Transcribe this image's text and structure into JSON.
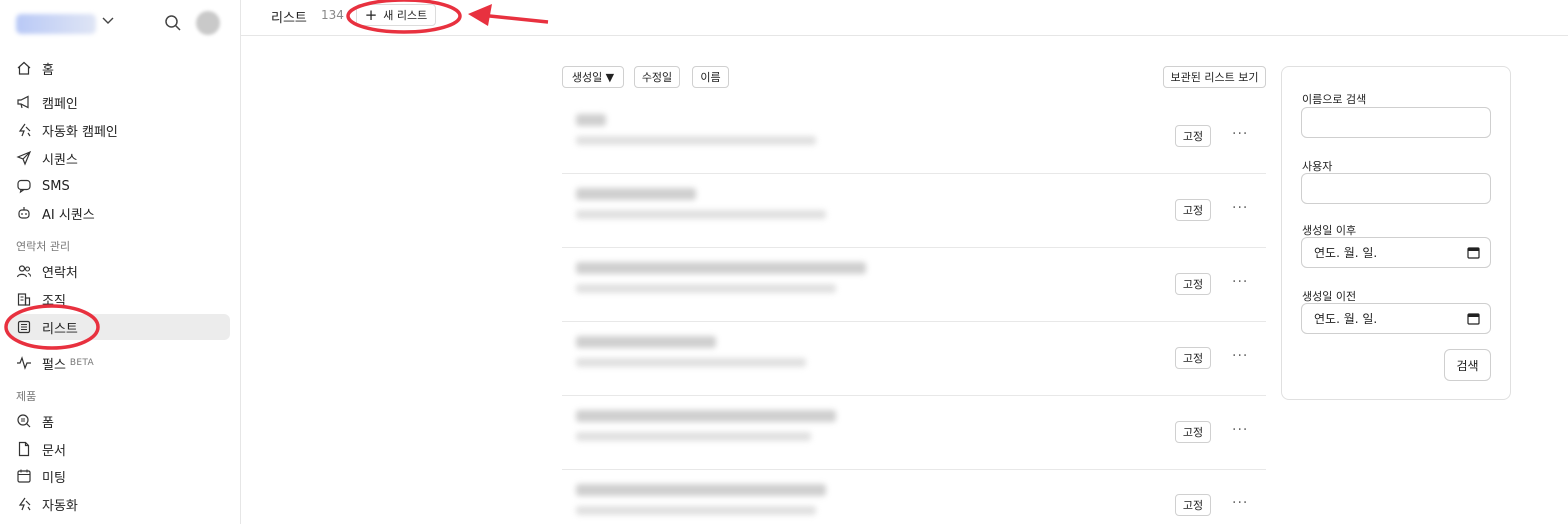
{
  "sidebar": {
    "nav_top": [
      {
        "label": "홈",
        "icon": "home-icon"
      },
      {
        "label": "캠페인",
        "icon": "megaphone-icon"
      },
      {
        "label": "자동화 캠페인",
        "icon": "automation-icon"
      },
      {
        "label": "시퀀스",
        "icon": "send-icon"
      },
      {
        "label": "SMS",
        "icon": "sms-icon"
      },
      {
        "label": "AI 시퀀스",
        "icon": "robot-icon"
      }
    ],
    "section_contacts": "연락처 관리",
    "nav_contacts": [
      {
        "label": "연락처",
        "icon": "people-icon"
      },
      {
        "label": "조직",
        "icon": "building-icon"
      },
      {
        "label": "리스트",
        "icon": "list-icon",
        "active": true
      },
      {
        "label": "펄스",
        "icon": "pulse-icon",
        "badge": "BETA"
      }
    ],
    "section_products": "제품",
    "nav_products": [
      {
        "label": "폼",
        "icon": "form-icon"
      },
      {
        "label": "문서",
        "icon": "document-icon"
      },
      {
        "label": "미팅",
        "icon": "calendar-icon"
      },
      {
        "label": "자동화",
        "icon": "automation-icon"
      }
    ]
  },
  "topbar": {
    "title": "리스트",
    "count": "134",
    "new_list_label": "새 리스트"
  },
  "sort": {
    "created": "생성일 ▼",
    "modified": "수정일",
    "name": "이름",
    "archived": "보관된 리스트 보기"
  },
  "rows": [
    {
      "pin_label": "고정",
      "more": "···"
    },
    {
      "pin_label": "고정",
      "more": "···"
    },
    {
      "pin_label": "고정",
      "more": "···"
    },
    {
      "pin_label": "고정",
      "more": "···"
    },
    {
      "pin_label": "고정",
      "more": "···"
    },
    {
      "pin_label": "고정",
      "more": "···"
    }
  ],
  "filter": {
    "name_label": "이름으로 검색",
    "name_value": "",
    "user_label": "사용자",
    "user_value": "",
    "after_label": "생성일 이후",
    "after_placeholder": "연도. 월. 일.",
    "before_label": "생성일 이전",
    "before_placeholder": "연도. 월. 일.",
    "search_label": "검색"
  },
  "colors": {
    "annotation": "#e8313f",
    "active_bg": "#ececec",
    "border": "#e6e6e6"
  }
}
